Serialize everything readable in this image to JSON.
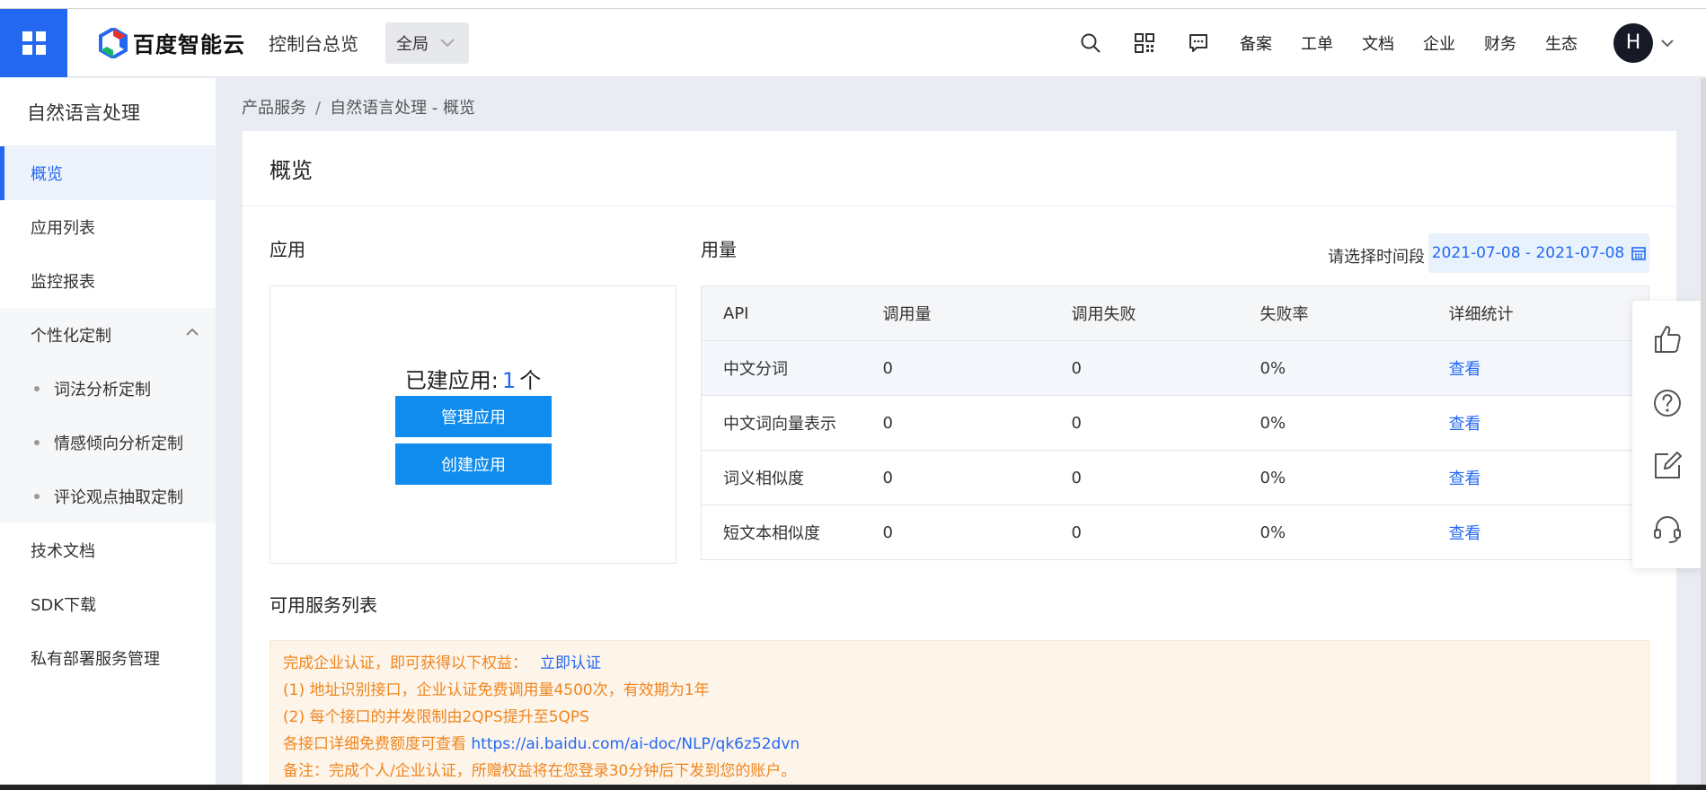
{
  "header": {
    "brand": "百度智能云",
    "console_overview": "控制台总览",
    "scope": "全局",
    "nav": [
      "备案",
      "工单",
      "文档",
      "企业",
      "财务",
      "生态"
    ],
    "avatar_letter": "H"
  },
  "sidebar": {
    "title": "自然语言处理",
    "items": {
      "overview": "概览",
      "app_list": "应用列表",
      "monitor": "监控报表",
      "custom": "个性化定制",
      "custom_lexer": "词法分析定制",
      "custom_sentiment": "情感倾向分析定制",
      "custom_comment": "评论观点抽取定制",
      "docs": "技术文档",
      "sdk": "SDK下载",
      "private_deploy": "私有部署服务管理"
    }
  },
  "breadcrumb": {
    "root": "产品服务",
    "sep": "/",
    "current": "自然语言处理 - 概览"
  },
  "panel": {
    "title": "概览",
    "apps_label": "应用",
    "app_count_prefix": "已建应用:",
    "app_count": "1",
    "app_count_suffix": "个",
    "manage_btn": "管理应用",
    "create_btn": "创建应用",
    "usage_label": "用量",
    "range_label": "请选择时间段",
    "range_value": "2021-07-08 - 2021-07-08",
    "services_label": "可用服务列表"
  },
  "table": {
    "headers": [
      "API",
      "调用量",
      "调用失败",
      "失败率",
      "详细统计"
    ],
    "rows": [
      {
        "api": "中文分词",
        "calls": "0",
        "fails": "0",
        "rate": "0%",
        "link": "查看"
      },
      {
        "api": "中文词向量表示",
        "calls": "0",
        "fails": "0",
        "rate": "0%",
        "link": "查看"
      },
      {
        "api": "词义相似度",
        "calls": "0",
        "fails": "0",
        "rate": "0%",
        "link": "查看"
      },
      {
        "api": "短文本相似度",
        "calls": "0",
        "fails": "0",
        "rate": "0%",
        "link": "查看"
      }
    ]
  },
  "notice": {
    "line1": "完成企业认证，即可获得以下权益：",
    "cta": "立即认证",
    "line2": "(1) 地址识别接口，企业认证免费调用量4500次，有效期为1年",
    "line3": "(2) 每个接口的并发限制由2QPS提升至5QPS",
    "line4_prefix": "各接口详细免费额度可查看",
    "line4_link": "https://ai.baidu.com/ai-doc/NLP/qk6z52dvn",
    "line5": "备注：完成个人/企业认证，所赠权益将在您登录30分钟后下发到您的账户。"
  },
  "colors": {
    "primary": "#2468f2",
    "button": "#108cee",
    "notice_text": "#f0861f"
  }
}
